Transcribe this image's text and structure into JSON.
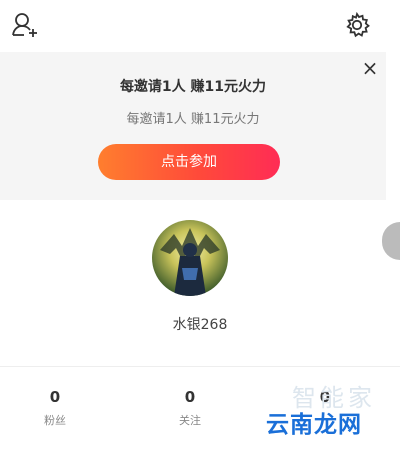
{
  "top_bar": {
    "add_friend_icon": "add-user-icon",
    "settings_icon": "gear-icon"
  },
  "banner": {
    "title": "每邀请1人 赚11元火力",
    "subtitle": "每邀请1人 赚11元火力",
    "button_label": "点击参加",
    "close_label": "×",
    "button_colors": [
      "#ff7e2e",
      "#ff2c55"
    ]
  },
  "profile": {
    "username": "水银268"
  },
  "stats": [
    {
      "value": "0",
      "label": "粉丝"
    },
    {
      "value": "0",
      "label": "关注"
    },
    {
      "value": "0",
      "label": ""
    }
  ],
  "watermark": {
    "top": "智能家",
    "main": "云南龙网"
  }
}
